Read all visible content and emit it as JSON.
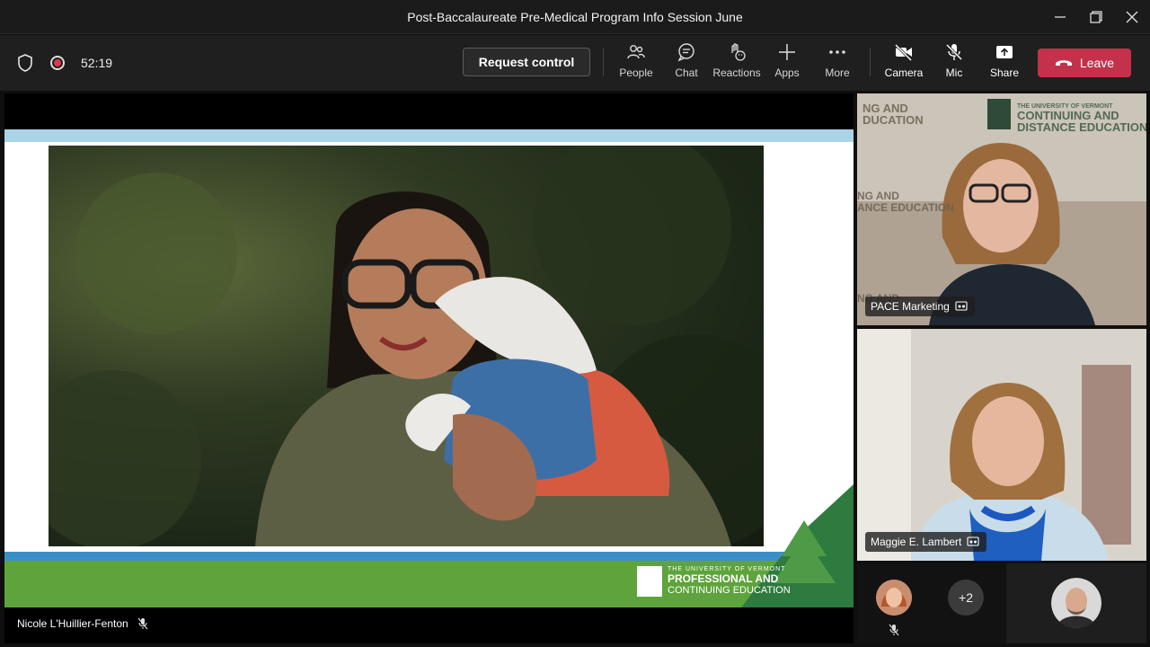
{
  "window": {
    "title": "Post-Baccalaureate Pre-Medical Program Info Session June"
  },
  "toolbar": {
    "timer": "52:19",
    "request_control_label": "Request control",
    "tools": [
      {
        "label": "People",
        "icon": "people-icon"
      },
      {
        "label": "Chat",
        "icon": "chat-icon"
      },
      {
        "label": "Reactions",
        "icon": "reactions-icon"
      },
      {
        "label": "Apps",
        "icon": "plus-icon"
      },
      {
        "label": "More",
        "icon": "more-icon"
      },
      {
        "label": "Camera",
        "icon": "camera-off-icon"
      },
      {
        "label": "Mic",
        "icon": "mic-off-icon"
      },
      {
        "label": "Share",
        "icon": "share-icon"
      }
    ],
    "leave_label": "Leave",
    "leave_color": "#c4314b"
  },
  "stage": {
    "presenter_name": "Nicole L'Huillier-Fenton",
    "slide": {
      "logo_small": "THE UNIVERSITY OF VERMONT",
      "logo_line1": "PROFESSIONAL AND",
      "logo_line2": "CONTINUING EDUCATION",
      "band_color": "#5ea33b",
      "accent_color": "#3c8fc6"
    }
  },
  "participants": {
    "tile1": {
      "name": "PACE Marketing",
      "backdrop_lines": [
        "THE UNIVERSITY OF VERMONT",
        "CONTINUING AND",
        "DISTANCE EDUCATION"
      ]
    },
    "tile2": {
      "name": "Maggie E. Lambert"
    },
    "overflow_count": "+2"
  }
}
